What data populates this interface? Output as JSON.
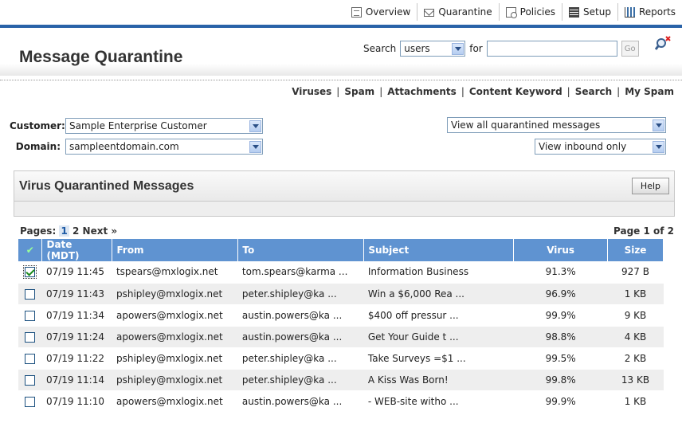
{
  "nav": {
    "tabs": [
      {
        "label": "Overview",
        "icon": "overview-icon"
      },
      {
        "label": "Quarantine",
        "icon": "mail-icon"
      },
      {
        "label": "Policies",
        "icon": "policies-icon"
      },
      {
        "label": "Setup",
        "icon": "setup-icon"
      },
      {
        "label": "Reports",
        "icon": "reports-icon"
      }
    ]
  },
  "header": {
    "title": "Message Quarantine",
    "search_label": "Search",
    "search_field_value": "users",
    "for_label": "for",
    "search_text": "",
    "go_label": "Go"
  },
  "links": [
    "Viruses",
    "Spam",
    "Attachments",
    "Content Keyword",
    "Search",
    "My Spam"
  ],
  "filters": {
    "customer_label": "Customer:",
    "customer_value": "Sample Enterprise Customer",
    "domain_label": "Domain:",
    "domain_value": "sampleentdomain.com",
    "view_messages": "View all quarantined messages",
    "view_direction": "View inbound only"
  },
  "panel": {
    "title": "Virus Quarantined Messages",
    "help_label": "Help"
  },
  "pager": {
    "label": "Pages:",
    "page1": "1",
    "page2": "2",
    "next": "Next »",
    "page_of": "Page 1 of 2"
  },
  "table": {
    "columns": [
      "Date (MDT)",
      "From",
      "To",
      "Subject",
      "Virus",
      "Size"
    ],
    "rows": [
      {
        "checked": true,
        "date": "07/19 11:45",
        "from": "tspears@mxlogix.net",
        "to": "tom.spears@karma ...",
        "subject": "Information Business",
        "virus": "91.3%",
        "size": "927 B"
      },
      {
        "checked": false,
        "date": "07/19 11:43",
        "from": "pshipley@mxlogix.net",
        "to": "peter.shipley@ka ...",
        "subject": "Win a $6,000 Rea ...",
        "virus": "96.9%",
        "size": "1 KB"
      },
      {
        "checked": false,
        "date": "07/19 11:34",
        "from": "apowers@mxlogix.net",
        "to": "austin.powers@ka ...",
        "subject": "$400 off pressur ...",
        "virus": "99.9%",
        "size": "9 KB"
      },
      {
        "checked": false,
        "date": "07/19 11:24",
        "from": "apowers@mxlogix.net",
        "to": "austin.powers@ka ...",
        "subject": "Get Your Guide t ...",
        "virus": "98.8%",
        "size": "4 KB"
      },
      {
        "checked": false,
        "date": "07/19 11:22",
        "from": "pshipley@mxlogix.net",
        "to": "peter.shipley@ka ...",
        "subject": "Take Surveys =$1 ...",
        "virus": "99.5%",
        "size": "2 KB"
      },
      {
        "checked": false,
        "date": "07/19 11:14",
        "from": "pshipley@mxlogix.net",
        "to": "peter.shipley@ka ...",
        "subject": "A Kiss Was Born!",
        "virus": "99.8%",
        "size": "13 KB"
      },
      {
        "checked": false,
        "date": "07/19 11:10",
        "from": "apowers@mxlogix.net",
        "to": "austin.powers@ka ...",
        "subject": "- WEB-site witho ...",
        "virus": "99.9%",
        "size": "1 KB"
      }
    ]
  },
  "colors": {
    "accent": "#2a63a8",
    "table_header": "#5f93d1"
  }
}
